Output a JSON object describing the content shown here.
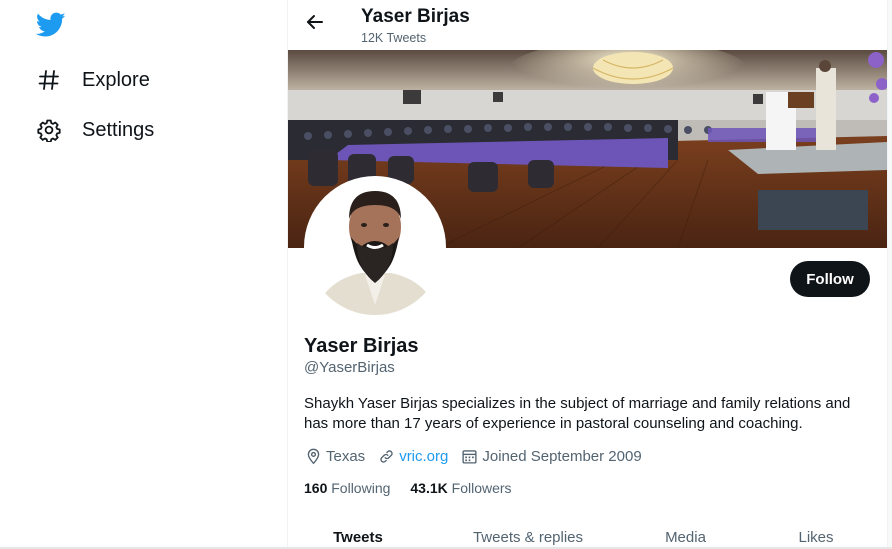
{
  "nav": {
    "logo_icon": "twitter-bird-icon",
    "items": [
      {
        "label": "Explore",
        "icon": "hashtag-icon"
      },
      {
        "label": "Settings",
        "icon": "gear-icon"
      }
    ]
  },
  "header": {
    "title": "Yaser Birjas",
    "subtitle": "12K Tweets",
    "back_icon": "arrow-left-icon"
  },
  "profile": {
    "name": "Yaser Birjas",
    "handle": "@YaserBirjas",
    "follow_label": "Follow",
    "bio": "Shaykh Yaser Birjas specializes in the subject of marriage and family relations and has more than 17 years of experience in pastoral counseling and coaching.",
    "location": "Texas",
    "website": "vric.org",
    "joined": "Joined September 2009",
    "following_count": "160",
    "following_label": "Following",
    "followers_count": "43.1K",
    "followers_label": "Followers"
  },
  "tabs": [
    {
      "label": "Tweets"
    },
    {
      "label": "Tweets & replies"
    },
    {
      "label": "Media"
    },
    {
      "label": "Likes"
    }
  ],
  "colors": {
    "brand_blue": "#1d9bf0",
    "text_primary": "#0f1419",
    "text_secondary": "#536471",
    "follow_button_bg": "#0f1419"
  }
}
